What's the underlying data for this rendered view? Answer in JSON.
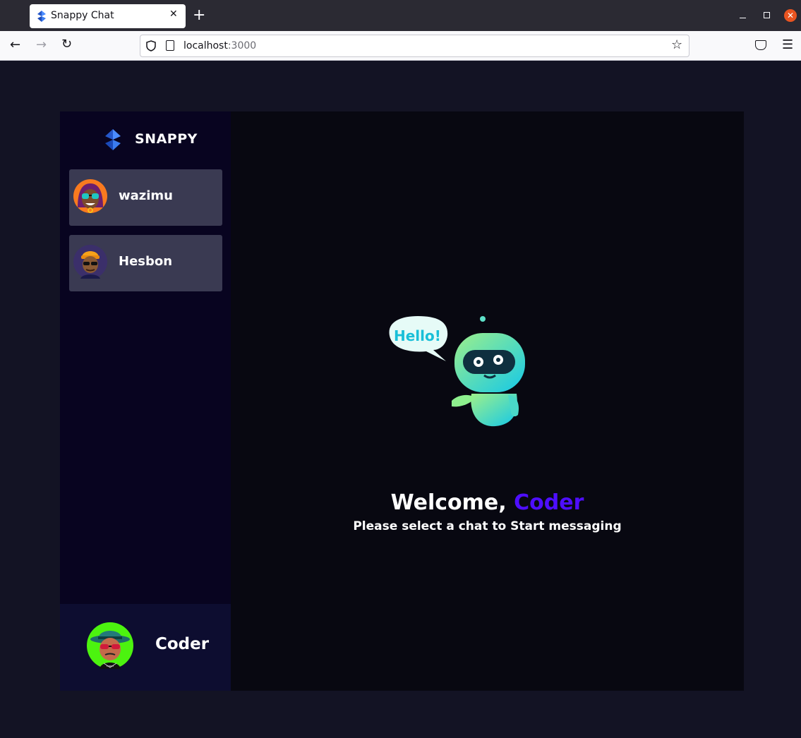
{
  "browser": {
    "tab_title": "Snappy Chat",
    "url_host": "localhost",
    "url_port": ":3000",
    "new_tab_glyph": "+",
    "close_glyph": "✕"
  },
  "app": {
    "brand": "SNAPPY",
    "contacts": [
      {
        "name": "wazimu",
        "avatar_icon": "avatar-wazimu-icon"
      },
      {
        "name": "Hesbon",
        "avatar_icon": "avatar-hesbon-icon"
      }
    ],
    "current_user": {
      "name": "Coder"
    },
    "welcome": {
      "greeting": "Welcome, ",
      "username": "Coder",
      "subtitle": "Please select a chat to Start messaging",
      "illustration_text": "Hello!"
    },
    "colors": {
      "accent": "#4e0eff",
      "sidebar_bg": "#080420",
      "contact_bg": "#3a3a52",
      "page_bg": "#131324"
    }
  }
}
